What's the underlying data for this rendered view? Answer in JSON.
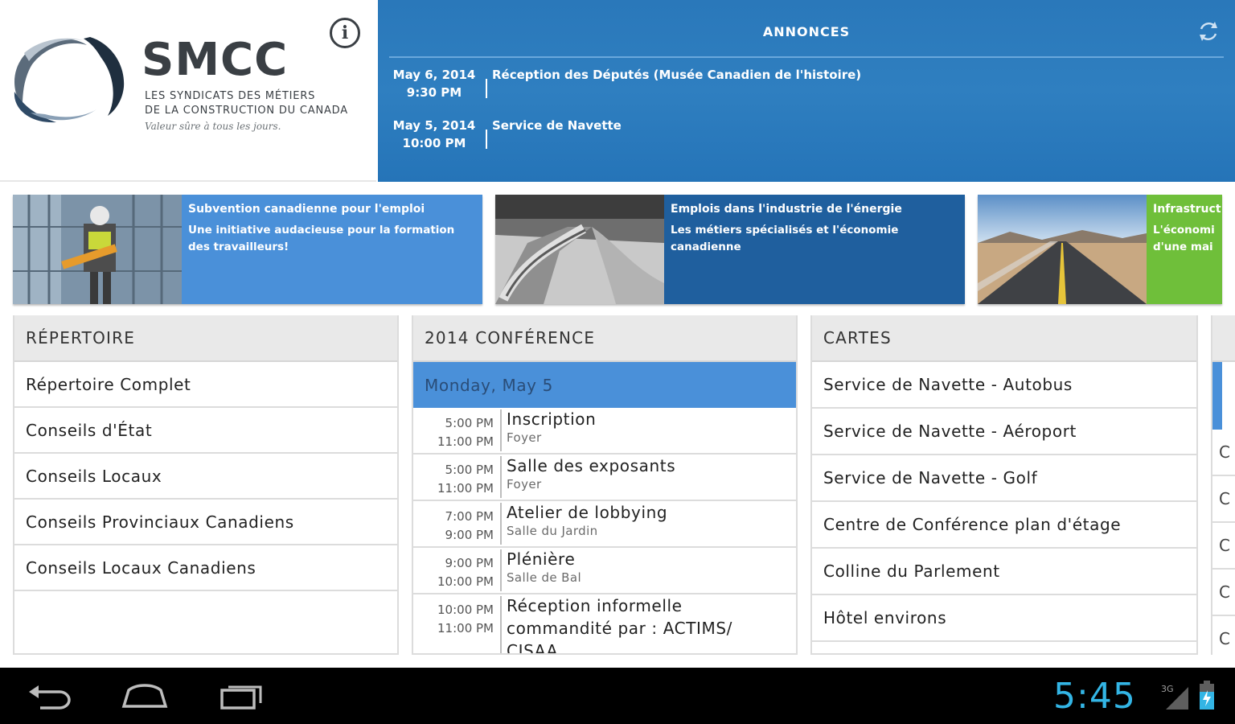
{
  "header": {
    "logo_title": "SMCC",
    "logo_sub1": "LES SYNDICATS DES MÉTIERS",
    "logo_sub2": "DE LA CONSTRUCTION DU CANADA",
    "logo_tag": "Valeur sûre à tous les jours."
  },
  "announcements": {
    "title": "ANNONCES",
    "items": [
      {
        "date": "May 6, 2014",
        "time": "9:30 PM",
        "text": "Réception des Députés (Musée Canadien de l'histoire)"
      },
      {
        "date": "May 5, 2014",
        "time": "10:00 PM",
        "text": "Service de Navette"
      }
    ]
  },
  "banners": [
    {
      "title": "Subvention canadienne pour l'emploi",
      "desc": "Une initiative audacieuse pour la formation des travailleurs!",
      "color": "#4a90d9"
    },
    {
      "title": "Emplois dans l'industrie de l'énergie",
      "desc": "Les métiers spécialisés et l'économie canadienne",
      "color": "#1f5f9e"
    },
    {
      "title": "Infrastruct",
      "desc": "L'économi d'une mai",
      "color": "#6fbf3a"
    }
  ],
  "directory": {
    "title": "RÉPERTOIRE",
    "items": [
      "Répertoire Complet",
      "Conseils d'État",
      "Conseils Locaux",
      "Conseils Provinciaux Canadiens",
      "Conseils Locaux Canadiens"
    ]
  },
  "conference": {
    "title": "2014 CONFÉRENCE",
    "day": "Monday, May 5",
    "events": [
      {
        "start": "5:00 PM",
        "end": "11:00 PM",
        "name": "Inscription",
        "location": "Foyer"
      },
      {
        "start": "5:00 PM",
        "end": "11:00 PM",
        "name": "Salle des exposants",
        "location": "Foyer"
      },
      {
        "start": "7:00 PM",
        "end": "9:00 PM",
        "name": "Atelier de lobbying",
        "location": "Salle du Jardin"
      },
      {
        "start": "9:00 PM",
        "end": "10:00 PM",
        "name": "Plénière",
        "location": "Salle de Bal"
      },
      {
        "start": "10:00 PM",
        "end": "11:00 PM",
        "name": "Réception informelle commandité par : ACTIMS/ CISAA",
        "location": ""
      }
    ]
  },
  "maps": {
    "title": "CARTES",
    "items": [
      "Service de Navette - Autobus",
      "Service de Navette - Aéroport",
      "Service de Navette - Golf",
      "Centre de Conférence plan d'étage",
      "Colline du Parlement",
      "Hôtel environs"
    ]
  },
  "partial_panel": {
    "row_labels": [
      "C",
      "C",
      "C",
      "C",
      "C"
    ]
  },
  "status": {
    "time": "5:45",
    "network": "3G"
  },
  "colors": {
    "accent_blue": "#2f7fc0",
    "highlight_blue": "#4a90d9",
    "clock": "#33b5e5"
  }
}
